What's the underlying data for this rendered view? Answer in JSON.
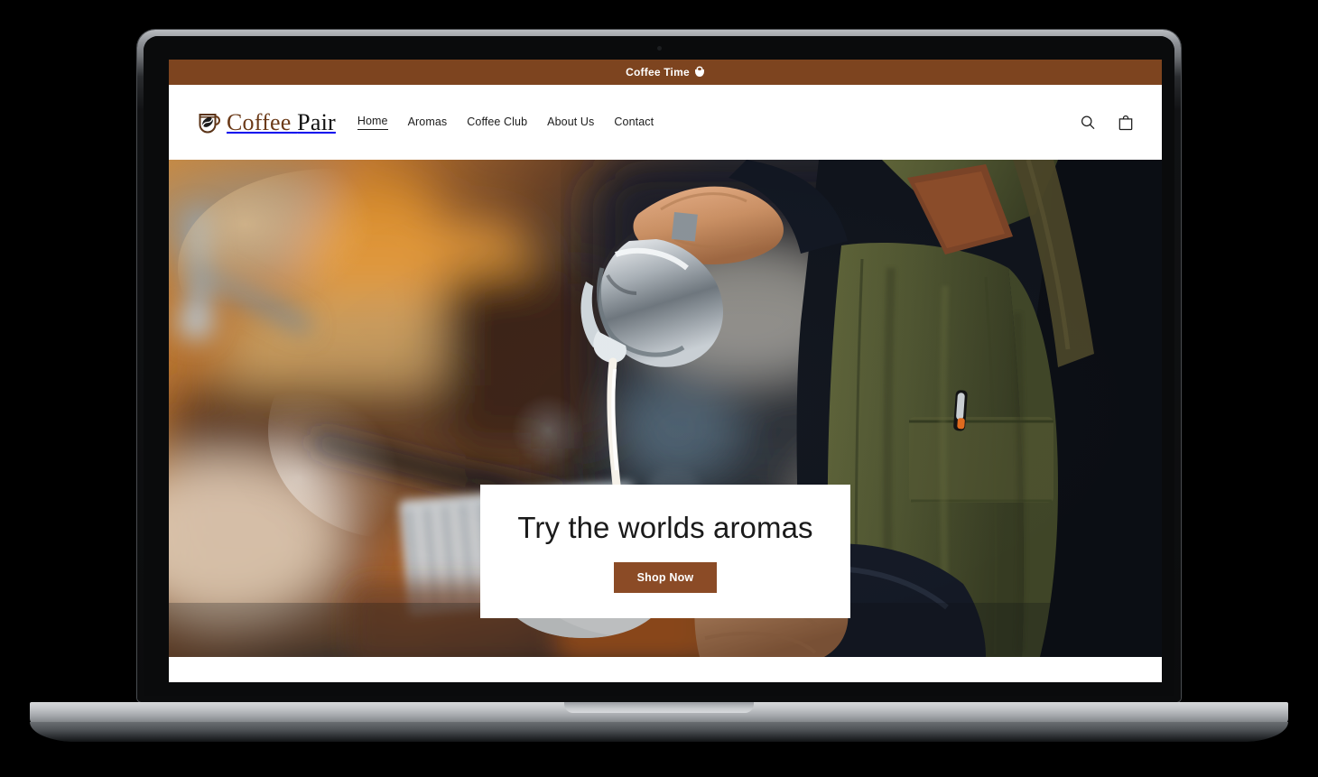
{
  "device": {
    "type": "laptop-mockup",
    "frame_color": "#2a2c2f",
    "base_color": "#c3c6c9"
  },
  "announcement": {
    "text": "Coffee Time",
    "icon": "coffee-cup-icon",
    "background": "#7d441f",
    "text_color": "#ffffff"
  },
  "header": {
    "logo": {
      "icon": "coffee-cup-bean-logo-icon",
      "text_primary": "Coffee",
      "text_secondary": "Pair",
      "primary_color": "#6b3a18",
      "secondary_color": "#101010"
    },
    "nav": [
      {
        "label": "Home",
        "active": true
      },
      {
        "label": "Aromas",
        "active": false
      },
      {
        "label": "Coffee Club",
        "active": false
      },
      {
        "label": "About Us",
        "active": false
      },
      {
        "label": "Contact",
        "active": false
      }
    ],
    "icons": [
      {
        "name": "search-icon",
        "label": "Search"
      },
      {
        "name": "shopping-bag-icon",
        "label": "Cart"
      }
    ],
    "background": "#ffffff"
  },
  "hero": {
    "image_alt": "Barista pouring steamed milk from a steel pitcher into a white cup of latte art beside an espresso machine",
    "card": {
      "heading": "Try the worlds aromas",
      "button_label": "Shop Now",
      "button_color": "#8b4b26",
      "card_background": "#ffffff",
      "heading_color": "#1a1a1a"
    }
  }
}
